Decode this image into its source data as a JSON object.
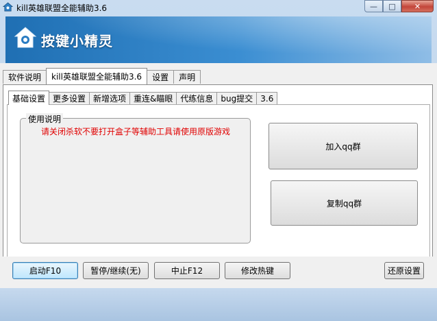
{
  "window": {
    "title": "kill英雄联盟全能辅助3.6",
    "min_glyph": "—",
    "max_glyph": "□",
    "close_glyph": "✕"
  },
  "banner": {
    "brand_name": "按键小精灵"
  },
  "main_tabs": [
    {
      "label": "软件说明"
    },
    {
      "label": "kill英雄联盟全能辅助3.6"
    },
    {
      "label": "设置"
    },
    {
      "label": "声明"
    }
  ],
  "sub_tabs": [
    {
      "label": "基础设置"
    },
    {
      "label": "更多设置"
    },
    {
      "label": "新增选项"
    },
    {
      "label": "重连&瞄眼"
    },
    {
      "label": "代练信息"
    },
    {
      "label": "bug提交"
    },
    {
      "label": "3.6"
    }
  ],
  "usage": {
    "title": "使用说明",
    "text": "请关闭杀软不要打开盒子等辅助工具请使用原版游戏"
  },
  "buttons": {
    "join_qq": "加入qq群",
    "copy_qq": "复制qq群",
    "start": "启动F10",
    "pause": "暂停/继续(无)",
    "stop": "中止F12",
    "hotkey": "修改热键",
    "restore": "还原设置"
  },
  "colors": {
    "warning_text": "#e00000",
    "banner": "#1f6fb3"
  }
}
